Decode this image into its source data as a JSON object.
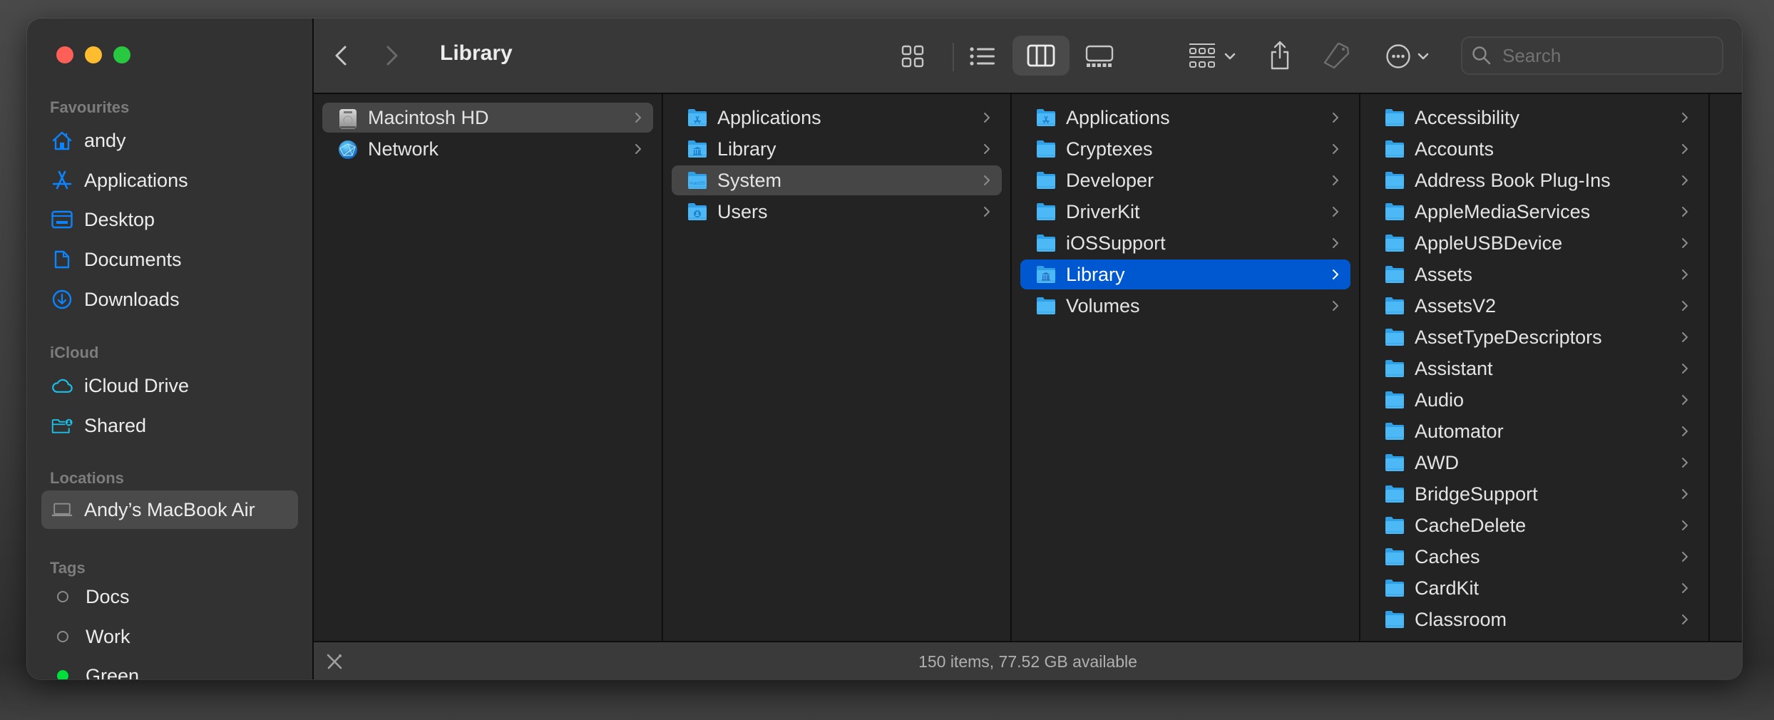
{
  "window": {
    "title": "Library"
  },
  "sidebar": {
    "sections": [
      {
        "header": "Favourites",
        "items": [
          {
            "label": "andy",
            "icon": "home-icon"
          },
          {
            "label": "Applications",
            "icon": "applications-icon"
          },
          {
            "label": "Desktop",
            "icon": "desktop-icon"
          },
          {
            "label": "Documents",
            "icon": "document-icon"
          },
          {
            "label": "Downloads",
            "icon": "download-icon"
          }
        ]
      },
      {
        "header": "iCloud",
        "items": [
          {
            "label": "iCloud Drive",
            "icon": "cloud-icon"
          },
          {
            "label": "Shared",
            "icon": "shared-folder-icon"
          }
        ]
      },
      {
        "header": "Locations",
        "items": [
          {
            "label": "Andy’s MacBook Air",
            "icon": "laptop-icon",
            "selected": true
          }
        ]
      },
      {
        "header": "Tags",
        "items": [
          {
            "label": "Docs",
            "icon": "tag-dot-icon",
            "color": ""
          },
          {
            "label": "Work",
            "icon": "tag-dot-icon",
            "color": ""
          },
          {
            "label": "Green",
            "icon": "tag-dot-icon",
            "color": "#00e03a"
          }
        ]
      }
    ]
  },
  "toolbar": {
    "back_label": "Back",
    "forward_label": "Forward",
    "views": [
      "icon-view",
      "list-view",
      "column-view",
      "gallery-view"
    ],
    "active_view": "column-view",
    "search_placeholder": "Search",
    "search_value": ""
  },
  "columns": [
    {
      "items": [
        {
          "name": "Macintosh HD",
          "icon": "hard-drive-icon",
          "state": "highlighted"
        },
        {
          "name": "Network",
          "icon": "network-globe-icon",
          "state": ""
        }
      ]
    },
    {
      "items": [
        {
          "name": "Applications",
          "icon": "applications-folder-icon",
          "state": ""
        },
        {
          "name": "Library",
          "icon": "library-folder-icon",
          "state": ""
        },
        {
          "name": "System",
          "icon": "system-folder-icon",
          "state": "highlighted"
        },
        {
          "name": "Users",
          "icon": "users-folder-icon",
          "state": ""
        }
      ]
    },
    {
      "items": [
        {
          "name": "Applications",
          "icon": "applications-folder-icon",
          "state": ""
        },
        {
          "name": "Cryptexes",
          "icon": "folder-icon",
          "state": ""
        },
        {
          "name": "Developer",
          "icon": "folder-icon",
          "state": ""
        },
        {
          "name": "DriverKit",
          "icon": "folder-icon",
          "state": ""
        },
        {
          "name": "iOSSupport",
          "icon": "folder-icon",
          "state": ""
        },
        {
          "name": "Library",
          "icon": "library-folder-icon",
          "state": "selected"
        },
        {
          "name": "Volumes",
          "icon": "folder-icon",
          "state": ""
        }
      ]
    },
    {
      "items": [
        {
          "name": "Accessibility",
          "icon": "folder-icon",
          "state": ""
        },
        {
          "name": "Accounts",
          "icon": "folder-icon",
          "state": ""
        },
        {
          "name": "Address Book Plug-Ins",
          "icon": "folder-icon",
          "state": ""
        },
        {
          "name": "AppleMediaServices",
          "icon": "folder-icon",
          "state": ""
        },
        {
          "name": "AppleUSBDevice",
          "icon": "folder-icon",
          "state": ""
        },
        {
          "name": "Assets",
          "icon": "folder-icon",
          "state": ""
        },
        {
          "name": "AssetsV2",
          "icon": "folder-icon",
          "state": ""
        },
        {
          "name": "AssetTypeDescriptors",
          "icon": "folder-icon",
          "state": ""
        },
        {
          "name": "Assistant",
          "icon": "folder-icon",
          "state": ""
        },
        {
          "name": "Audio",
          "icon": "folder-icon",
          "state": ""
        },
        {
          "name": "Automator",
          "icon": "folder-icon",
          "state": ""
        },
        {
          "name": "AWD",
          "icon": "folder-icon",
          "state": ""
        },
        {
          "name": "BridgeSupport",
          "icon": "folder-icon",
          "state": ""
        },
        {
          "name": "CacheDelete",
          "icon": "folder-icon",
          "state": ""
        },
        {
          "name": "Caches",
          "icon": "folder-icon",
          "state": ""
        },
        {
          "name": "CardKit",
          "icon": "folder-icon",
          "state": ""
        },
        {
          "name": "Classroom",
          "icon": "folder-icon",
          "state": ""
        }
      ]
    },
    {
      "items": []
    }
  ],
  "statusbar": {
    "text": "150 items, 77.52 GB available"
  },
  "colors": {
    "accent": "#0058d0",
    "sidebar_icon": "#0a84ff",
    "icloud_icon": "#1ac0e8",
    "folder": "#4cb8f5"
  }
}
